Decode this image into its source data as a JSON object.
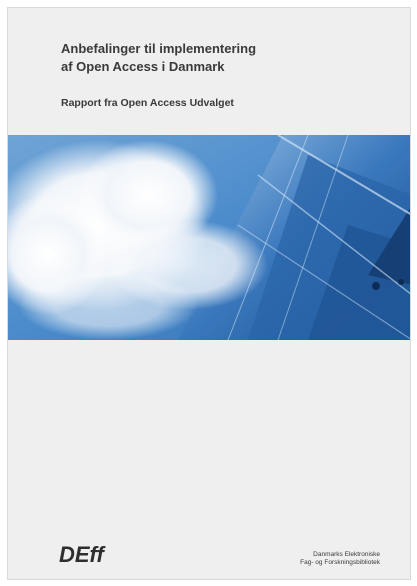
{
  "cover": {
    "title_lines": [
      "Anbefalinger til implementering",
      "af Open Access i Danmark"
    ],
    "subtitle": "Rapport fra Open Access Udvalget"
  },
  "footer": {
    "logo_text": "DEff",
    "org_lines": [
      "Danmarks Elektroniske",
      "Fag- og Forskningsbibliotek"
    ]
  },
  "colors": {
    "page_background": "#efeff0",
    "text": "#3a3a3a",
    "sky_blue": "#3f7fc0",
    "glass_dark": "#1f4f8e"
  }
}
